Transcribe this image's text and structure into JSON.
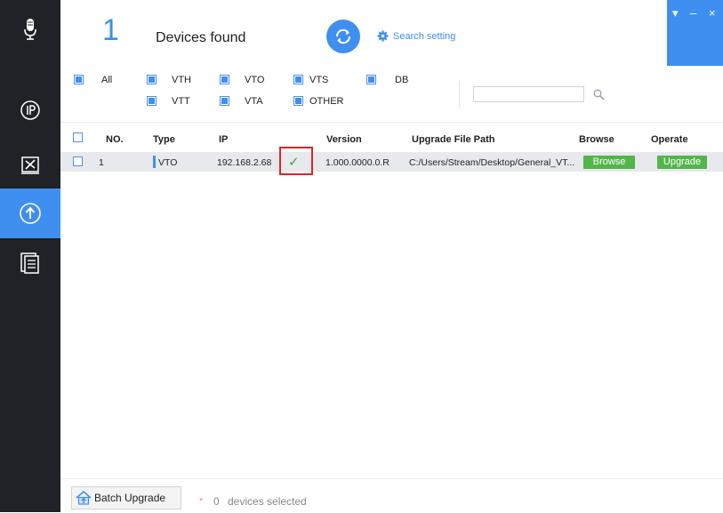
{
  "sidebar": {
    "items": [
      {
        "icon": "microphone-icon"
      },
      {
        "icon": "ip-icon"
      },
      {
        "icon": "tools-icon"
      },
      {
        "icon": "upgrade-icon",
        "active": true
      },
      {
        "icon": "document-icon"
      }
    ]
  },
  "header": {
    "found_count": "1",
    "found_label": "Devices found",
    "search_setting": "Search setting"
  },
  "window_controls": {
    "menu": "▾",
    "minimize": "–",
    "close": "×"
  },
  "filters": {
    "all": "All",
    "options": [
      "VTH",
      "VTO",
      "VTS",
      "DB",
      "VTT",
      "VTA",
      "OTHER"
    ],
    "search_value": ""
  },
  "table": {
    "headers": [
      "NO.",
      "Type",
      "IP",
      "Version",
      "Upgrade File Path",
      "Browse",
      "Operate"
    ],
    "rows": [
      {
        "no": "1",
        "type": "VTO",
        "ip": "192.168.2.68",
        "status": "✓",
        "version": "1.000.0000.0.R",
        "path": "C:/Users/Stream/Desktop/General_VT...",
        "browse": "Browse",
        "operate": "Upgrade"
      }
    ]
  },
  "footer": {
    "batch_upgrade": "Batch Upgrade",
    "star": "*",
    "selected_count": "0",
    "selected_label": "devices selected"
  },
  "colors": {
    "accent": "#3f8ff0",
    "sidebar": "#1f2226",
    "green": "#52b64a",
    "highlight": "#e02424"
  }
}
